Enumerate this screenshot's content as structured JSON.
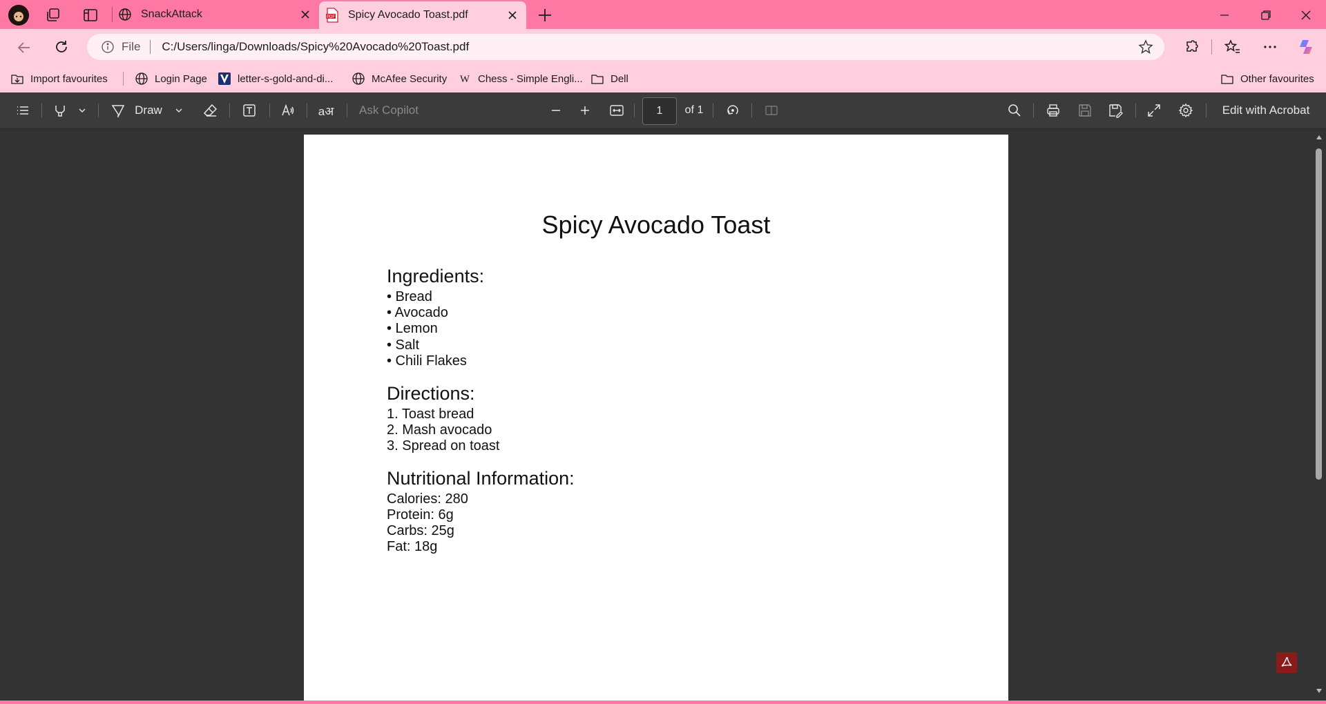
{
  "browser": {
    "tabs": [
      {
        "title": "SnackAttack"
      },
      {
        "title": "Spicy Avocado Toast.pdf"
      }
    ],
    "address": {
      "file_label": "File",
      "url": "C:/Users/linga/Downloads/Spicy%20Avocado%20Toast.pdf"
    },
    "favourites": [
      {
        "label": "Import favourites",
        "icon": "import-icon"
      },
      {
        "label": "Login Page",
        "icon": "globe-icon"
      },
      {
        "label": "letter-s-gold-and-di...",
        "icon": "v-logo-icon"
      },
      {
        "label": "McAfee Security",
        "icon": "globe-icon"
      },
      {
        "label": "Chess - Simple Engli...",
        "icon": "wikipedia-icon"
      },
      {
        "label": "Dell",
        "icon": "folder-icon"
      }
    ],
    "other_favourites": "Other favourites"
  },
  "pdf_toolbar": {
    "draw_label": "Draw",
    "ask_copilot": "Ask Copilot",
    "page_current": "1",
    "page_total": "of 1",
    "edit_acrobat": "Edit with Acrobat"
  },
  "document": {
    "title": "Spicy Avocado Toast",
    "ingredients_heading": "Ingredients:",
    "ingredients": [
      "• Bread",
      "• Avocado",
      "• Lemon",
      "• Salt",
      "• Chili Flakes"
    ],
    "directions_heading": "Directions:",
    "directions": [
      "1. Toast bread",
      "2. Mash avocado",
      "3. Spread on toast"
    ],
    "nutrition_heading": "Nutritional Information:",
    "nutrition": [
      "Calories: 280",
      "Protein: 6g",
      "Carbs: 25g",
      "Fat: 18g"
    ]
  },
  "colors": {
    "titlebar": "#ff78a4",
    "toolbar_bg": "#ffcfe0",
    "pdf_toolbar": "#3b3b3b",
    "viewer_bg": "#333333"
  }
}
